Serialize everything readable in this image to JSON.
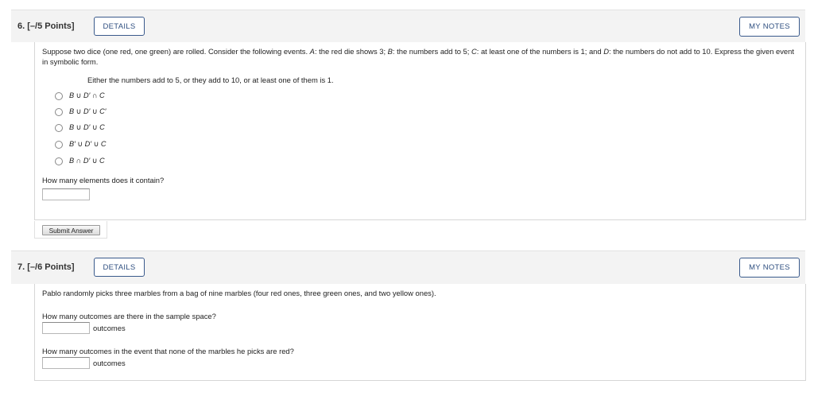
{
  "q6": {
    "title": "6. [–/5 Points]",
    "details_label": "DETAILS",
    "notes_label": "MY NOTES",
    "prompt_parts": {
      "p1": "Suppose two dice (one red, one green) are rolled. Consider the following events. ",
      "a": "A",
      "p2": ": the red die shows 3; ",
      "b": "B",
      "p3": ": the numbers add to 5; ",
      "c": "C",
      "p4": ": at least one of the numbers is 1; and ",
      "d": "D",
      "p5": ": the numbers do not add to 10. Express the given event in symbolic form."
    },
    "event_text": "Either the numbers add to 5, or they add to 10, or at least one of them is 1.",
    "options": [
      "B ∪ D′ ∩ C",
      "B ∪ D′ ∪ C′",
      "B ∪ D′ ∪ C",
      "B′ ∪ D′ ∪ C",
      "B ∩ D′ ∪ C"
    ],
    "elements_question": "How many elements does it contain?",
    "elements_value": "",
    "submit_label": "Submit Answer"
  },
  "q7": {
    "title": "7. [–/6 Points]",
    "details_label": "DETAILS",
    "notes_label": "MY NOTES",
    "prompt": "Pablo randomly picks three marbles from a bag of nine marbles (four red ones, three green ones, and two yellow ones).",
    "question1": "How many outcomes are there in the sample space?",
    "answer1_value": "",
    "unit1": "outcomes",
    "question2": "How many outcomes in the event that none of the marbles he picks are red?",
    "answer2_value": "",
    "unit2": "outcomes"
  }
}
